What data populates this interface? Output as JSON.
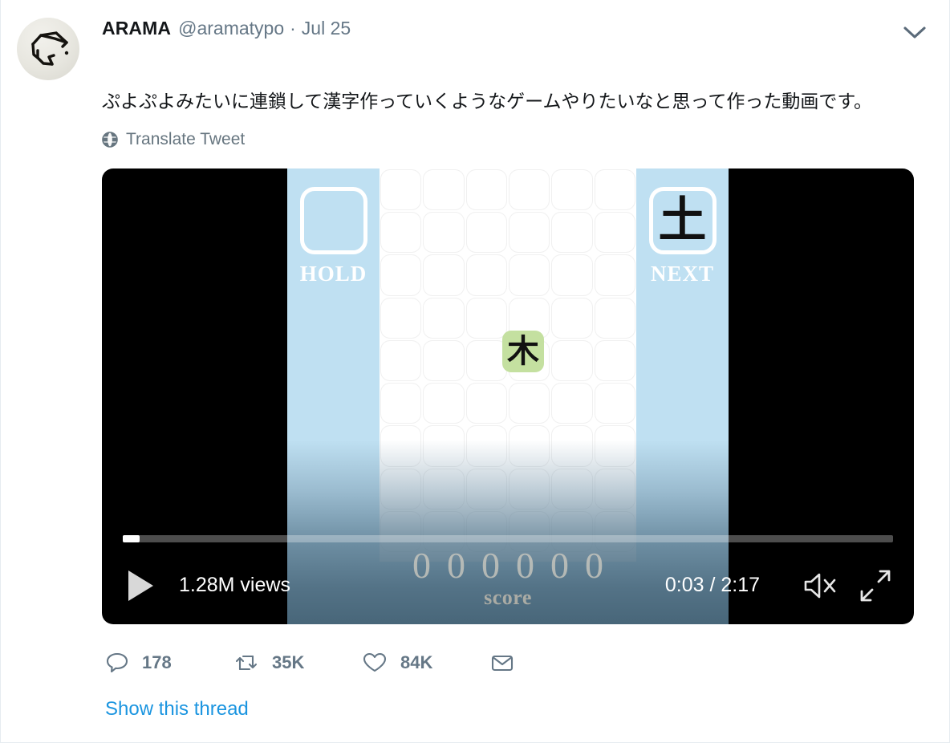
{
  "tweet": {
    "display_name": "ARAMA",
    "handle": "@aramatypo",
    "separator": "·",
    "date": "Jul 25",
    "text": "ぷよぷよみたいに連鎖して漢字作っていくようなゲームやりたいなと思って作った動画です。",
    "translate_label": "Translate Tweet",
    "caret_icon": "chevron-down-icon",
    "globe_icon": "globe-icon",
    "avatar_icon": "user-avatar"
  },
  "video": {
    "views_label": "1.28M views",
    "time_label": "0:03 / 2:17",
    "progress_percent": "2.2",
    "play_icon": "play-icon",
    "mute_icon": "volume-muted-icon",
    "fullscreen_icon": "fullscreen-icon"
  },
  "game": {
    "hold_label": "HOLD",
    "hold_piece": "",
    "next_label": "NEXT",
    "next_piece": "土",
    "falling_piece": "木",
    "score_digits": "000000",
    "score_label": "score",
    "colors": {
      "panel_blue": "#bfe0f2",
      "tile_green": "#c4e0a0",
      "board_white": "#ffffff"
    }
  },
  "actions": [
    {
      "name": "reply",
      "icon": "reply-icon",
      "count": "178"
    },
    {
      "name": "retweet",
      "icon": "retweet-icon",
      "count": "35K"
    },
    {
      "name": "like",
      "icon": "heart-icon",
      "count": "84K"
    },
    {
      "name": "share",
      "icon": "envelope-icon",
      "count": ""
    }
  ],
  "footer": {
    "show_thread_label": "Show this thread"
  }
}
